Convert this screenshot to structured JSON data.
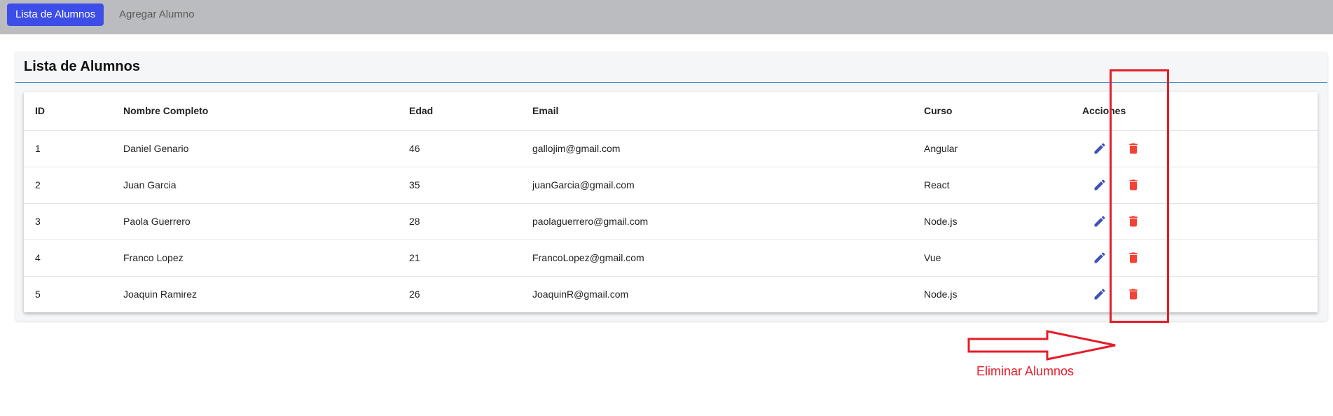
{
  "nav": {
    "active_label": "Lista de Alumnos",
    "add_label": "Agregar Alumno"
  },
  "card": {
    "title": "Lista de Alumnos"
  },
  "table": {
    "headers": {
      "id": "ID",
      "name": "Nombre Completo",
      "age": "Edad",
      "email": "Email",
      "course": "Curso",
      "actions": "Acciones"
    },
    "rows": [
      {
        "id": "1",
        "name": "Daniel Genario",
        "age": "46",
        "email": "gallojim@gmail.com",
        "course": "Angular"
      },
      {
        "id": "2",
        "name": "Juan Garcia",
        "age": "35",
        "email": "juanGarcia@gmail.com",
        "course": "React"
      },
      {
        "id": "3",
        "name": "Paola Guerrero",
        "age": "28",
        "email": "paolaguerrero@gmail.com",
        "course": "Node.js"
      },
      {
        "id": "4",
        "name": "Franco Lopez",
        "age": "21",
        "email": "FrancoLopez@gmail.com",
        "course": "Vue"
      },
      {
        "id": "5",
        "name": "Joaquin Ramirez",
        "age": "26",
        "email": "JoaquinR@gmail.com",
        "course": "Node.js"
      }
    ]
  },
  "icons": {
    "edit": "pencil-icon",
    "delete": "trash-icon"
  },
  "colors": {
    "primary": "#3d4de8",
    "edit_icon": "#3f51b5",
    "delete_icon": "#f44336",
    "annotation": "#e51d2a",
    "topbar": "#bbbcbf"
  },
  "annotation": {
    "label": "Eliminar Alumnos"
  }
}
